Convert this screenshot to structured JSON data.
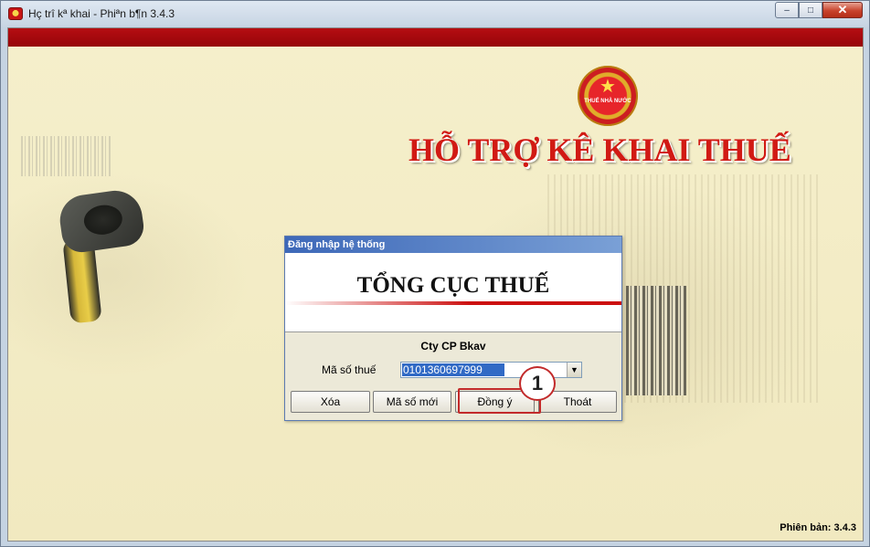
{
  "window": {
    "title": "Hç trî kª khai - Phiªn b¶n 3.4.3",
    "controls": {
      "minimize": "–",
      "maximize": "□",
      "close": "✕"
    }
  },
  "app": {
    "brand_title": "HỖ TRỢ KÊ KHAI THUẾ",
    "emblem_text": "THUẾ NHÀ NƯỚC",
    "version_text": "Phiên bản: 3.4.3"
  },
  "dialog": {
    "title": "Đăng nhập hệ thống",
    "banner": "TỔNG CỤC THUẾ",
    "company": "Cty CP Bkav",
    "tax_id_label": "Mã số thuế",
    "tax_id_value": "0101360697999",
    "buttons": {
      "delete": "Xóa",
      "new_tax_id": "Mã số mới",
      "ok": "Đồng ý",
      "exit": "Thoát"
    }
  },
  "annotation": {
    "callout_number": "1",
    "color": "#c22a2a"
  },
  "colors": {
    "title_red": "#d11a14",
    "header_bar": "#b50d12",
    "selection_blue": "#316ac5"
  }
}
